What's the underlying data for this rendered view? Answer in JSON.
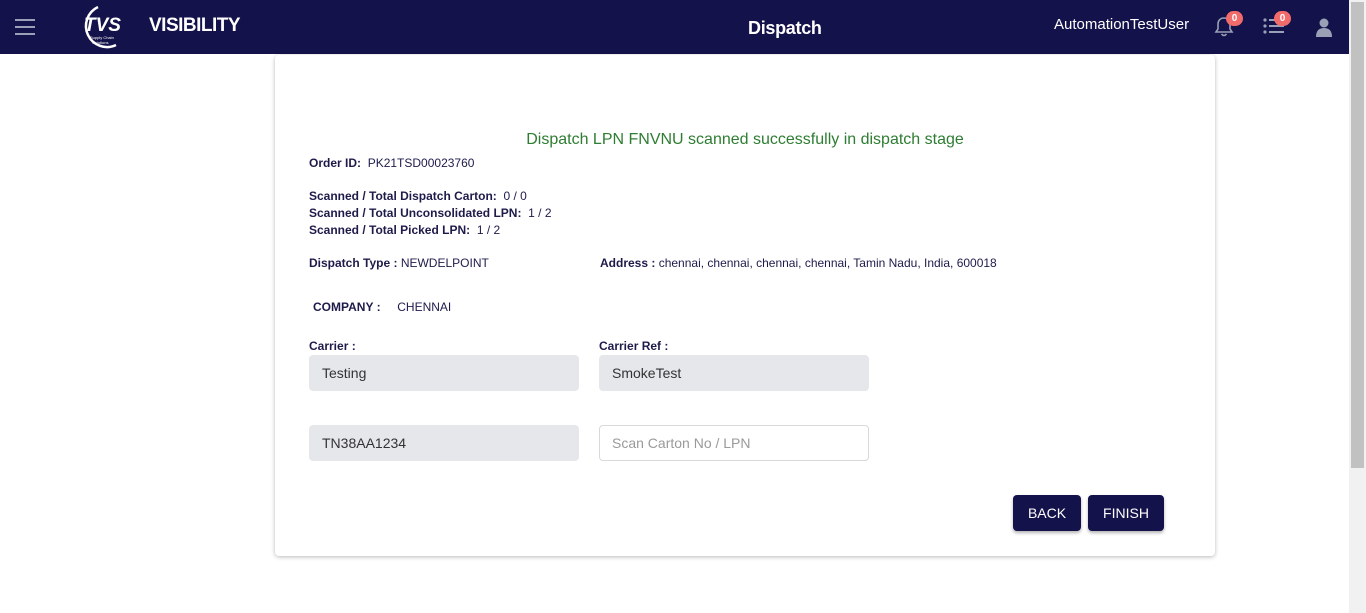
{
  "header": {
    "brand_logo_text": "TVS",
    "brand_logo_subtext": "Supply Chain Solutions",
    "brand": "VISIBILITY",
    "title": "Dispatch",
    "username": "AutomationTestUser",
    "notifications_count": "0",
    "tasks_count": "0"
  },
  "message": "Dispatch LPN FNVNU scanned successfully in dispatch stage",
  "order": {
    "id_label": "Order ID:",
    "id_value": "PK21TSD00023760",
    "carton_label": "Scanned / Total Dispatch Carton:",
    "carton_value": "0 / 0",
    "unconsolidated_label": "Scanned / Total Unconsolidated LPN:",
    "unconsolidated_value": "1 / 2",
    "picked_label": "Scanned / Total Picked LPN:",
    "picked_value": "1 / 2",
    "dispatch_type_label": "Dispatch Type :",
    "dispatch_type_value": "NEWDELPOINT",
    "address_label": "Address :",
    "address_value": "chennai, chennai, chennai, chennai, Tamin Nadu, India, 600018",
    "company_label": "COMPANY :",
    "company_value": "CHENNAI"
  },
  "form": {
    "carrier_label": "Carrier :",
    "carrier_value": "Testing",
    "carrier_ref_label": "Carrier Ref :",
    "carrier_ref_value": "SmokeTest",
    "vehicle_value": "TN38AA1234",
    "scan_value": "",
    "scan_placeholder": "Scan Carton No / LPN"
  },
  "buttons": {
    "back": "BACK",
    "finish": "FINISH"
  },
  "colors": {
    "header_bg": "#14124a",
    "success": "#2e7d32",
    "badge": "#f26b6b"
  }
}
